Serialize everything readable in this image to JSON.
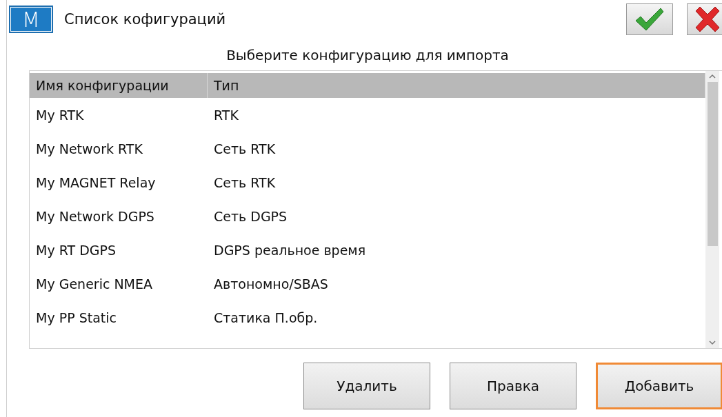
{
  "window": {
    "logo": "M",
    "title": "Список кофигураций"
  },
  "subtitle": "Выберите конфигурацию для импорта",
  "table": {
    "columns": [
      "Имя конфигурации",
      "Тип"
    ],
    "rows": [
      {
        "cells": [
          "My RTK",
          "RTK"
        ]
      },
      {
        "cells": [
          "My Network RTK",
          "Сеть RTK"
        ]
      },
      {
        "cells": [
          "My MAGNET Relay",
          "Сеть RTK"
        ]
      },
      {
        "cells": [
          "My Network DGPS",
          "Сеть DGPS"
        ]
      },
      {
        "cells": [
          "My RT DGPS",
          "DGPS реальное время"
        ]
      },
      {
        "cells": [
          "My Generic NMEA",
          "Автономно/SBAS"
        ]
      },
      {
        "cells": [
          "My PP Static",
          "Статика П.обр."
        ]
      }
    ]
  },
  "buttons": [
    {
      "label": "Удалить",
      "focused": false
    },
    {
      "label": "Правка",
      "focused": false
    },
    {
      "label": "Добавить",
      "focused": true
    }
  ]
}
